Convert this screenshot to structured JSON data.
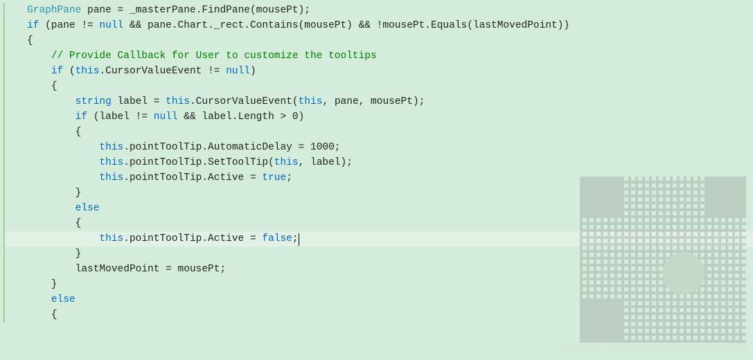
{
  "code": {
    "l1": {
      "t1": "GraphPane",
      "t2": " pane = _masterPane.FindPane(mousePt);"
    },
    "l2": {
      "k1": "if",
      "t1": " (pane != ",
      "k2": "null",
      "t2": " && pane.Chart._rect.Contains(mousePt) && !mousePt.Equals(lastMovedPoint))"
    },
    "l3": "{",
    "l4": "// Provide Callback for User to customize the tooltips",
    "l5": {
      "k1": "if",
      "t1": " (",
      "k2": "this",
      "t2": ".CursorValueEvent != ",
      "k3": "null",
      "t3": ")"
    },
    "l6": "{",
    "l7": {
      "k1": "string",
      "t1": " label = ",
      "k2": "this",
      "t2": ".CursorValueEvent(",
      "k3": "this",
      "t3": ", pane, mousePt);"
    },
    "l8": {
      "k1": "if",
      "t1": " (label != ",
      "k2": "null",
      "t2": " && label.Length > 0)"
    },
    "l9": "{",
    "l10": {
      "k1": "this",
      "t1": ".pointToolTip.AutomaticDelay = 1000;"
    },
    "l11": {
      "k1": "this",
      "t1": ".pointToolTip.SetToolTip(",
      "k2": "this",
      "t2": ", label);"
    },
    "l12": {
      "k1": "this",
      "t1": ".pointToolTip.Active = ",
      "k2": "true",
      "t2": ";"
    },
    "l13": "}",
    "l14": "else",
    "l15": "{",
    "l16": {
      "k1": "this",
      "t1": ".pointToolTip.Active = ",
      "k2": "false",
      "t2": ";"
    },
    "l17": "}",
    "l18": "lastMovedPoint = mousePt;",
    "l19": "}",
    "l20": "else",
    "l21": "{"
  },
  "indent": {
    "i0": "",
    "i1": "    ",
    "i2": "        ",
    "i3": "            ",
    "i4": "                "
  },
  "watermark": "https://blog.csdn.net/BADAO_LIU@51CTO博客"
}
